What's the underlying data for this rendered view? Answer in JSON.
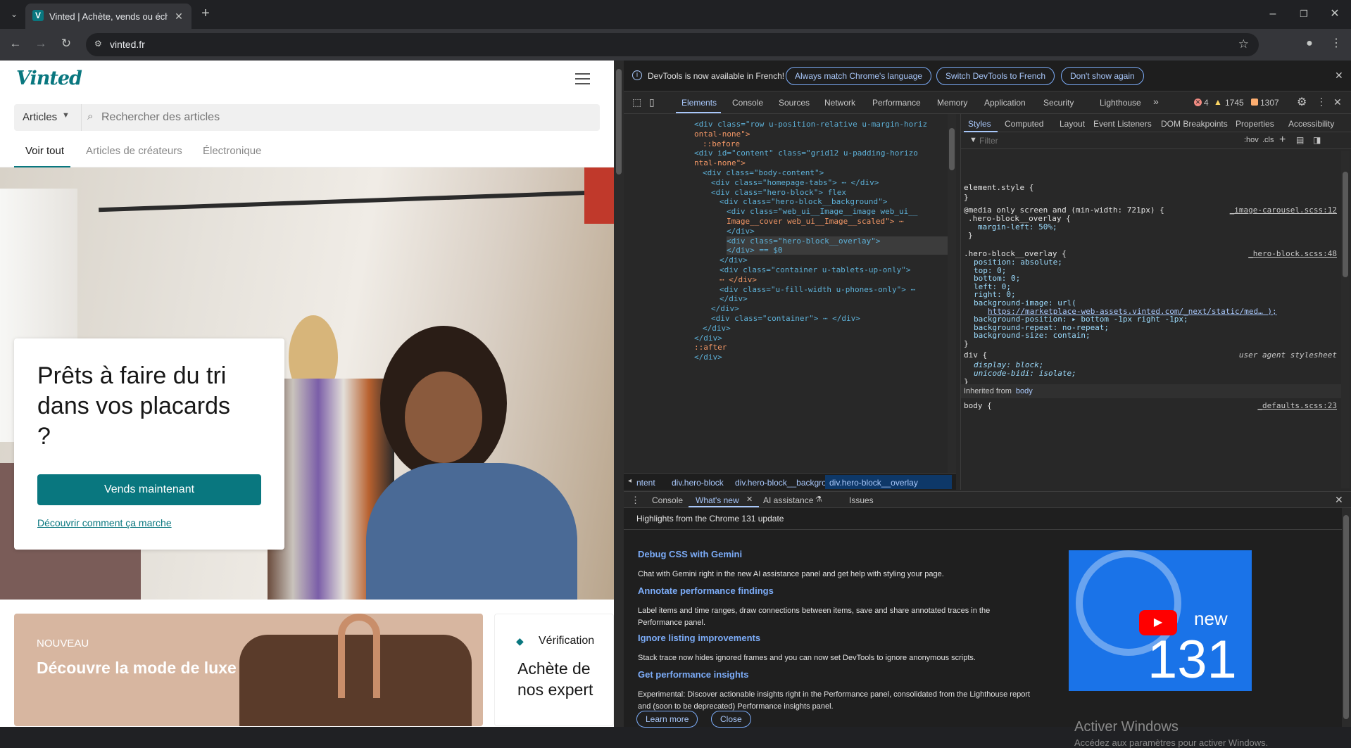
{
  "browser": {
    "tab_title": "Vinted | Achète, vends ou échange",
    "url": "vinted.fr",
    "new_tab": "+"
  },
  "vinted": {
    "logo": "Vinted",
    "search": {
      "category": "Articles",
      "placeholder": "Rechercher des articles"
    },
    "tabs": [
      "Voir tout",
      "Articles de créateurs",
      "Électronique"
    ],
    "hero": {
      "title": "Prêts à faire du tri dans vos placards ?",
      "cta": "Vends maintenant",
      "link": "Découvrir comment ça marche"
    },
    "luxury": {
      "badge": "NOUVEAU",
      "title": "Découvre la mode de luxe"
    },
    "verification": {
      "label": "Vérification",
      "title": "Achète de nos expert"
    }
  },
  "devtools": {
    "infobar": {
      "text": "DevTools is now available in French!",
      "btn1": "Always match Chrome's language",
      "btn2": "Switch DevTools to French",
      "btn3": "Don't show again"
    },
    "tabs": [
      "Elements",
      "Console",
      "Sources",
      "Network",
      "Performance",
      "Memory",
      "Application",
      "Security",
      "Lighthouse"
    ],
    "counts": {
      "errors": "4",
      "warnings": "1745",
      "info": "1307"
    },
    "elements": [
      {
        "indent": 0,
        "html": "<div class=\"row u-position-relative u-margin-horiz"
      },
      {
        "indent": 0,
        "html": "ontal-none\">"
      },
      {
        "indent": 1,
        "html": "::before"
      },
      {
        "indent": 0,
        "html": "<div id=\"content\" class=\"grid12 u-padding-horizo"
      },
      {
        "indent": 0,
        "html": "ntal-none\">"
      },
      {
        "indent": 1,
        "html": "<div class=\"body-content\">"
      },
      {
        "indent": 2,
        "html": "<div class=\"homepage-tabs\"> ⋯ </div>"
      },
      {
        "indent": 2,
        "html": "<div class=\"hero-block\"> flex"
      },
      {
        "indent": 3,
        "html": "<div class=\"hero-block__background\">"
      },
      {
        "indent": 4,
        "html": "<div class=\"web_ui__Image__image web_ui__"
      },
      {
        "indent": 4,
        "html": "Image__cover web_ui__Image__scaled\"> ⋯"
      },
      {
        "indent": 4,
        "html": "</div>"
      },
      {
        "indent": 4,
        "html": "<div class=\"hero-block__overlay\">"
      },
      {
        "indent": 4,
        "html": "</div> == $0"
      },
      {
        "indent": 3,
        "html": "</div>"
      },
      {
        "indent": 3,
        "html": "<div class=\"container u-tablets-up-only\">"
      },
      {
        "indent": 3,
        "html": "⋯ </div>"
      },
      {
        "indent": 3,
        "html": "<div class=\"u-fill-width u-phones-only\"> ⋯"
      },
      {
        "indent": 3,
        "html": "</div>"
      },
      {
        "indent": 2,
        "html": "</div>"
      },
      {
        "indent": 2,
        "html": "<div class=\"container\"> ⋯ </div>"
      },
      {
        "indent": 1,
        "html": "</div>"
      },
      {
        "indent": 0,
        "html": "</div>"
      },
      {
        "indent": 0,
        "html": "::after"
      },
      {
        "indent": 0,
        "html": "</div>"
      }
    ],
    "breadcrumbs": [
      "ntent",
      "div.hero-block",
      "div.hero-block__background",
      "div.hero-block__overlay"
    ],
    "styles_tabs": [
      "Styles",
      "Computed",
      "Layout",
      "Event Listeners",
      "DOM Breakpoints",
      "Properties",
      "Accessibility"
    ],
    "filter_placeholder": "Filter",
    "hov": ":hov",
    "cls": ".cls",
    "styles": {
      "element_style": "element.style {",
      "media": "@media only screen and (min-width: 721px) {",
      "media_src": "_image-carousel.scss:12",
      "media_rule": ".hero-block__overlay {",
      "media_decl": "margin-left: 50%;",
      "overlay_rule": ".hero-block__overlay {",
      "overlay_src": "_hero-block.scss:48",
      "decls": [
        "position: absolute;",
        "top: 0;",
        "bottom: 0;",
        "left: 0;",
        "right: 0;",
        "background-image: url(",
        "https://marketplace-web-assets.vinted.com/_next/static/med… );",
        "background-position: ▸ bottom -1px right -1px;",
        "background-repeat: no-repeat;",
        "background-size: contain;"
      ],
      "div_rule": "div {",
      "ua": "user agent stylesheet",
      "div_decls": [
        "display: block;",
        "unicode-bidi: isolate;"
      ],
      "inherited": "Inherited from",
      "inherited_el": "body",
      "body_rule": "body {",
      "body_src": "_defaults.scss:23"
    },
    "drawer_tabs": [
      "Console",
      "What's new",
      "AI assistance",
      "Issues"
    ],
    "whatsnew": {
      "heading": "Highlights from the Chrome 131 update",
      "items": [
        {
          "title": "Debug CSS with Gemini",
          "text": "Chat with Gemini right in the new AI assistance panel and get help with styling your page."
        },
        {
          "title": "Annotate performance findings",
          "text": "Label items and time ranges, draw connections between items, save and share annotated traces in the Performance panel."
        },
        {
          "title": "Ignore listing improvements",
          "text": "Stack trace now hides ignored frames and you can now set DevTools to ignore anonymous scripts."
        },
        {
          "title": "Get performance insights",
          "text": "Experimental: Discover actionable insights right in the Performance panel, consolidated from the Lighthouse report and (soon to be deprecated) Performance insights panel."
        }
      ],
      "learn_more": "Learn more",
      "close": "Close",
      "promo_new": "new",
      "promo_num": "131"
    },
    "watermark": {
      "title": "Activer Windows",
      "text": "Accédez aux paramètres pour activer Windows."
    }
  },
  "colors": {
    "vinted_teal": "#09777f",
    "devtools_blue": "#7cacf8"
  }
}
